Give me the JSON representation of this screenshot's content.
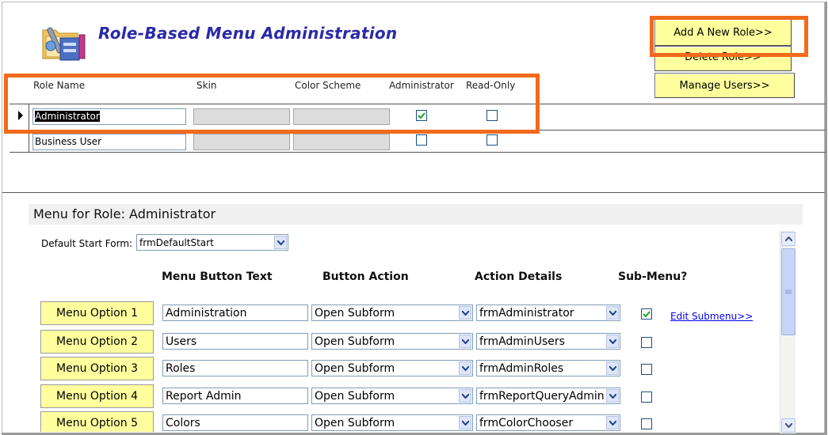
{
  "header": {
    "title": "Role-Based Menu Administration",
    "icon": "folder-tools-icon"
  },
  "actions": {
    "add_role": "Add A New Role>>",
    "delete_role": "Delete Role>>",
    "manage_users": "Manage Users>>"
  },
  "roles_table": {
    "columns": [
      "Role Name",
      "Skin",
      "Color Scheme",
      "Administrator",
      "Read-Only"
    ],
    "rows": [
      {
        "role_name": "Administrator",
        "skin": "",
        "color_scheme": "",
        "administrator": true,
        "read_only": false,
        "selected": true
      },
      {
        "role_name": "Business User",
        "skin": "",
        "color_scheme": "",
        "administrator": false,
        "read_only": false,
        "selected": false
      }
    ]
  },
  "menu": {
    "title": "Menu for Role: Administrator",
    "default_start_label": "Default Start Form:",
    "default_start_value": "frmDefaultStart",
    "columns": [
      "Menu Button Text",
      "Button Action",
      "Action Details",
      "Sub-Menu?"
    ],
    "edit_submenu_label": "Edit Submenu>>",
    "options": [
      {
        "label": "Menu Option 1",
        "text": "Administration",
        "action": "Open Subform",
        "details": "frmAdministrator",
        "submenu": true
      },
      {
        "label": "Menu Option 2",
        "text": "Users",
        "action": "Open Subform",
        "details": "frmAdminUsers",
        "submenu": false
      },
      {
        "label": "Menu Option 3",
        "text": "Roles",
        "action": "Open Subform",
        "details": "frmAdminRoles",
        "submenu": false
      },
      {
        "label": "Menu Option 4",
        "text": "Report Admin",
        "action": "Open Subform",
        "details": "frmReportQueryAdmin",
        "submenu": false
      },
      {
        "label": "Menu Option 5",
        "text": "Colors",
        "action": "Open Subform",
        "details": "frmColorChooser",
        "submenu": false
      }
    ]
  },
  "colors": {
    "title": "#2a2aa8",
    "highlight": "#f26a1b",
    "button_yellow": "#ffff9e"
  }
}
